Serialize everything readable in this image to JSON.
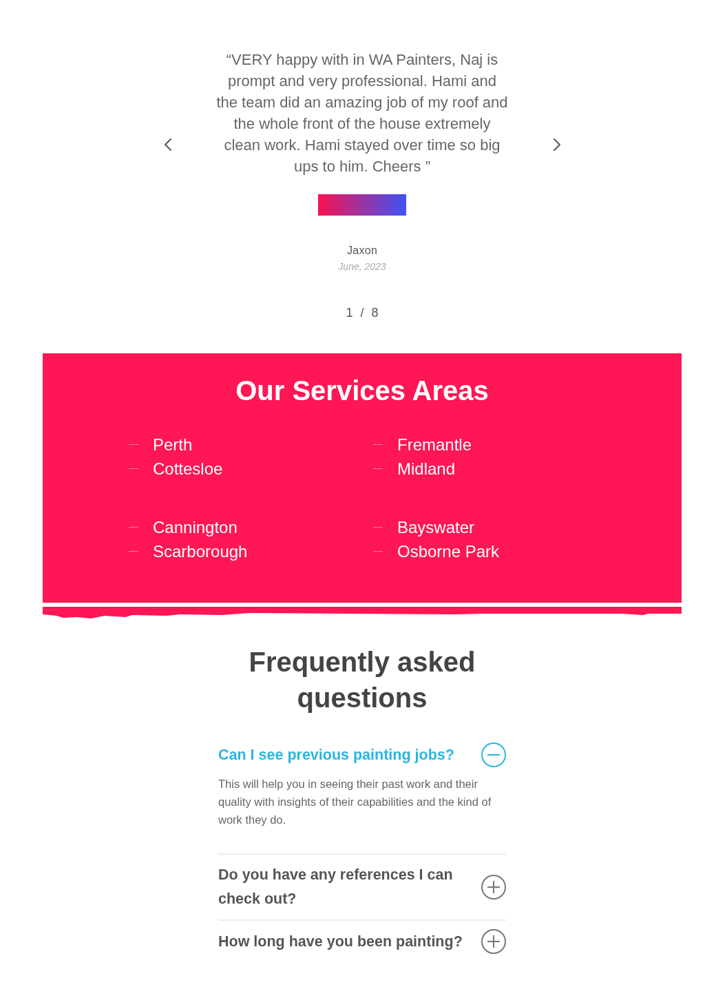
{
  "testimonial": {
    "quote": "“VERY happy with in WA Painters, Naj is prompt and very professional. Hami and the team did an amazing job of my roof and the whole front of the house extremely clean work. Hami stayed over time so big ups to him. Cheers ”",
    "author": "Jaxon",
    "date": "June, 2023",
    "counter": "1 / 8"
  },
  "service_areas": {
    "title": "Our Services Areas",
    "groups": [
      {
        "columns": [
          {
            "items": [
              "Perth",
              "Cottesloe"
            ]
          },
          {
            "items": [
              "Fremantle",
              "Midland"
            ]
          }
        ]
      },
      {
        "columns": [
          {
            "items": [
              "Cannington",
              "Scarborough"
            ]
          },
          {
            "items": [
              "Bayswater",
              "Osborne Park"
            ]
          }
        ]
      }
    ]
  },
  "faq": {
    "title": "Frequently asked questions",
    "items": [
      {
        "question": "Can I see previous painting jobs?",
        "answer": "This will help you in seeing their past work and their quality with insights of their capabilities and the kind of work they do.",
        "expanded": true
      },
      {
        "question": "Do you have any references I can check out?",
        "expanded": false
      },
      {
        "question": "How long have you been painting?",
        "expanded": false
      }
    ]
  }
}
